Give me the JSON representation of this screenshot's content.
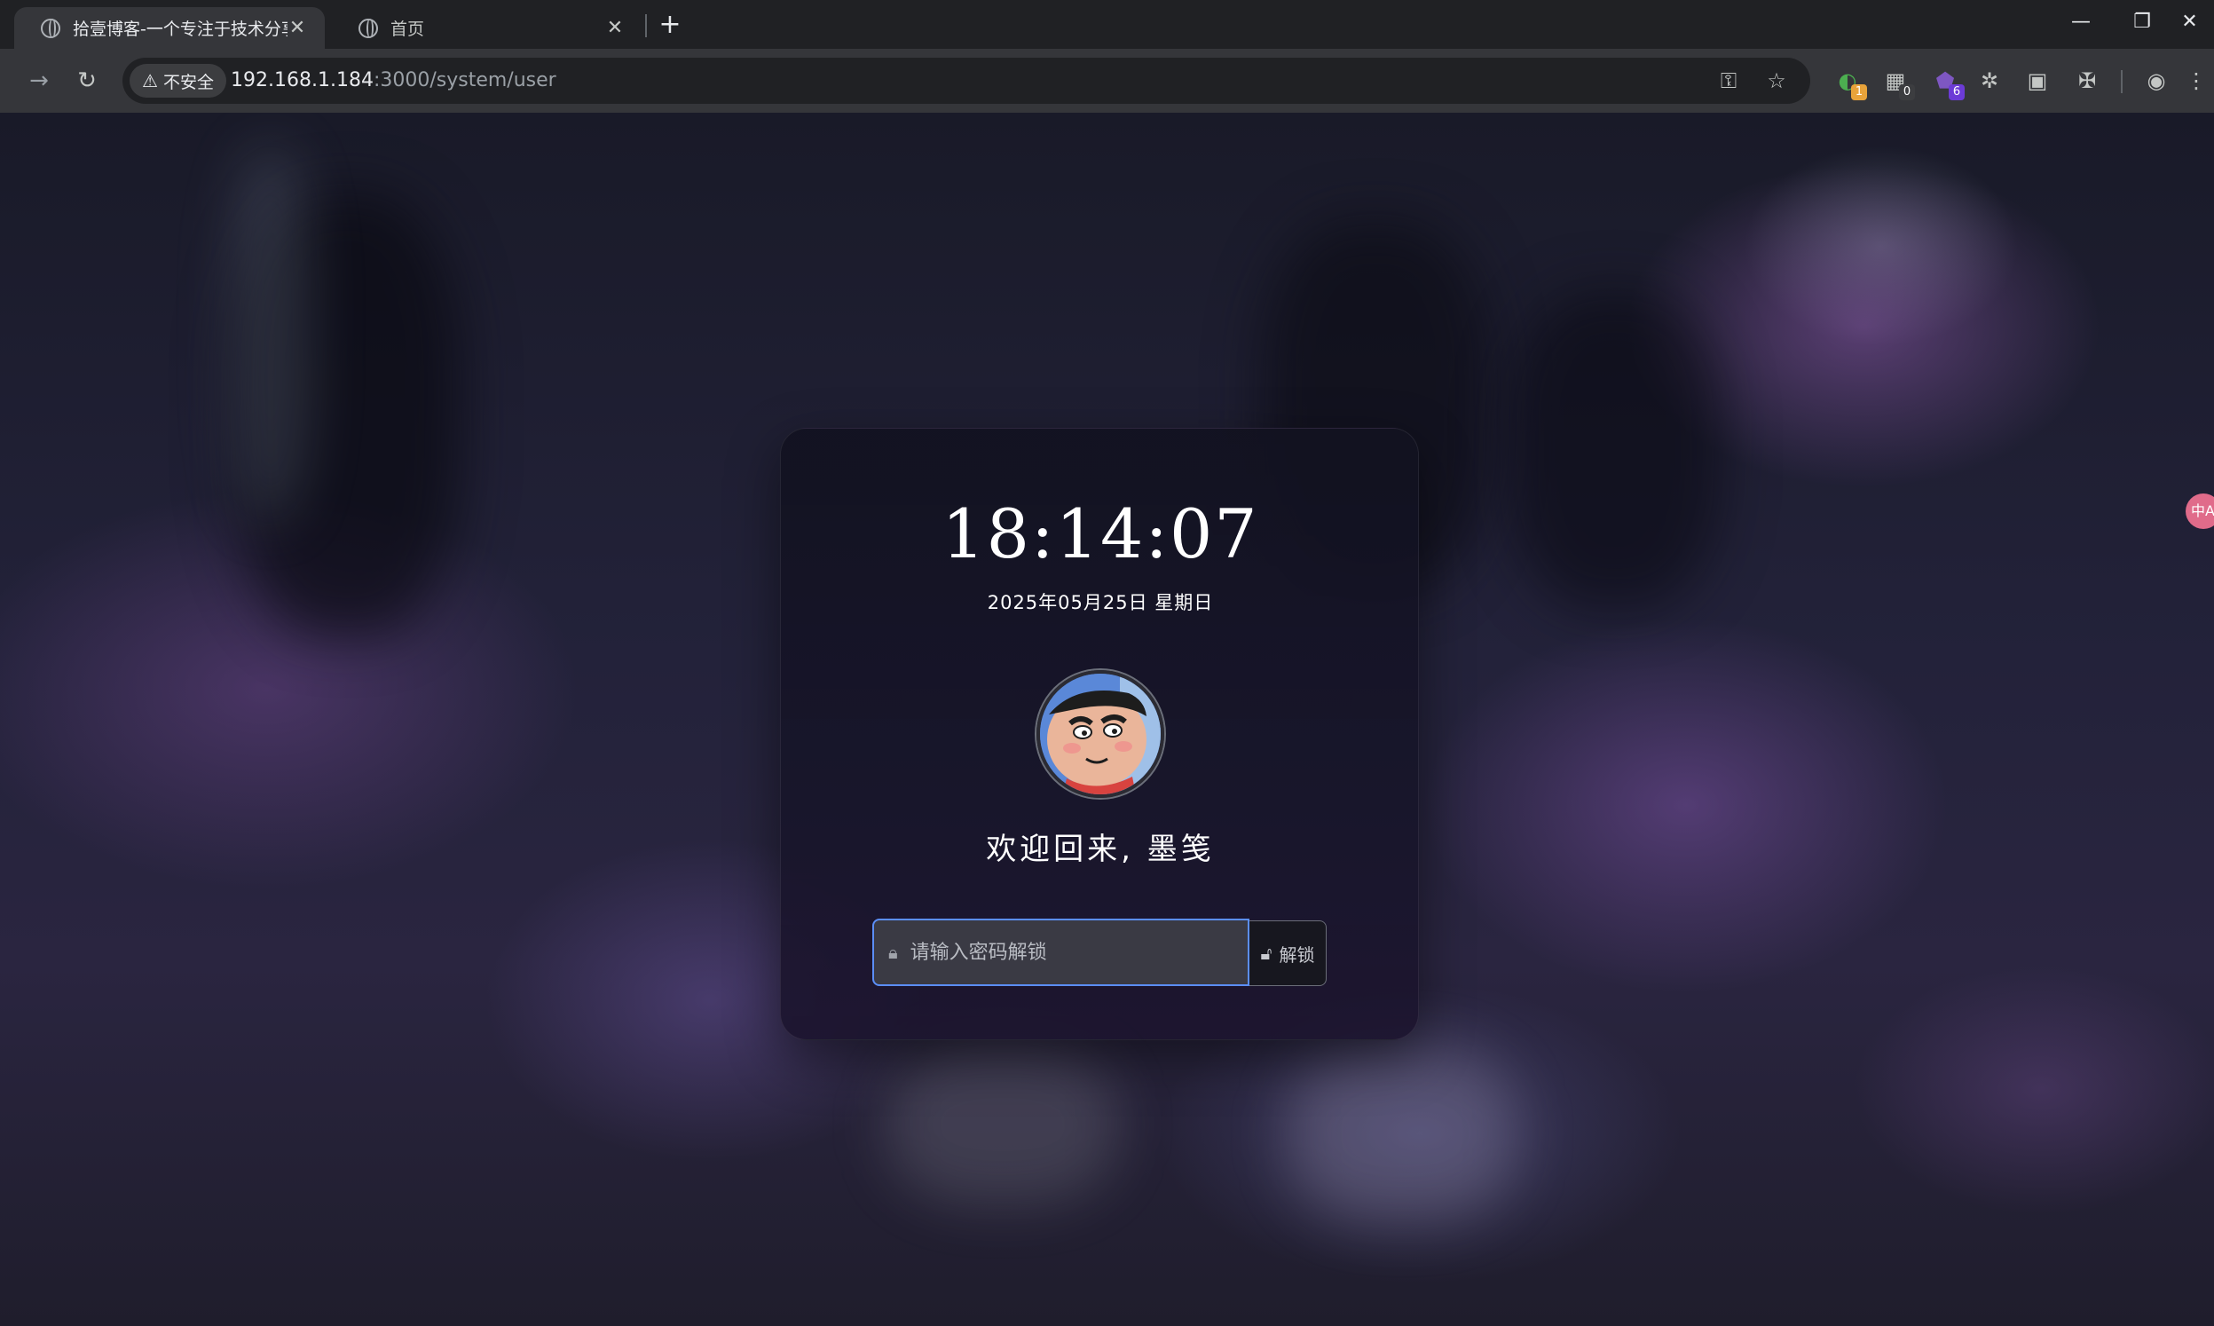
{
  "browser": {
    "tabs": [
      {
        "title": "拾壹博客-一个专注于技术分享",
        "active": true
      },
      {
        "title": "首页",
        "active": false
      }
    ],
    "new_tab": "+",
    "window_controls": {
      "minimize": "—",
      "restore": "❐",
      "close": "✕"
    },
    "security_label": "不安全",
    "url_host": "192.168.1.184",
    "url_path": ":3000/system/user",
    "extensions": [
      {
        "name": "ext-green",
        "badge": "1",
        "badge_color": "#e8a33a"
      },
      {
        "name": "ext-grid",
        "badge": "0",
        "badge_color": "#3c3d40"
      },
      {
        "name": "ext-purple",
        "badge": "6",
        "badge_color": "#6c3bd6"
      }
    ]
  },
  "lockscreen": {
    "time": "18:14:07",
    "date": "2025年05月25日  星期日",
    "welcome": "欢迎回来, 墨笺",
    "password_placeholder": "请输入密码解锁",
    "unlock_label": "解锁"
  },
  "side_widget": {
    "label": "中A"
  }
}
